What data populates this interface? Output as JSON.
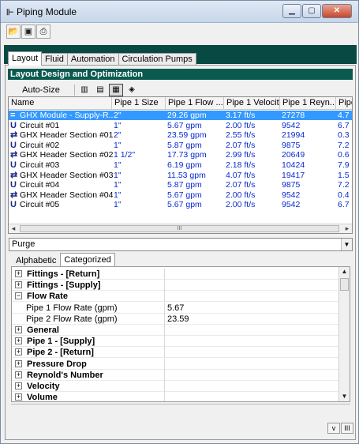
{
  "window": {
    "title": "Piping Module"
  },
  "toolbar": {
    "open_icon": "open-folder-icon",
    "save_icon": "save-icon",
    "print_icon": "print-icon"
  },
  "tabs": [
    {
      "label": "Layout",
      "active": true
    },
    {
      "label": "Fluid",
      "active": false
    },
    {
      "label": "Automation",
      "active": false
    },
    {
      "label": "Circulation Pumps",
      "active": false
    }
  ],
  "section": {
    "title": "Layout Design and Optimization"
  },
  "layout_toolbar": {
    "autosize_label": "Auto-Size"
  },
  "grid": {
    "columns": [
      "Name",
      "Pipe 1 Size",
      "Pipe 1 Flow ...",
      "Pipe 1 Velocity",
      "Pipe 1 Reyn...",
      "Pipe"
    ],
    "rows": [
      {
        "icon": "=",
        "name": "GHX Module - Supply-R...",
        "size": "2\"",
        "flow": "29.26 gpm",
        "velocity": "3.17 ft/s",
        "reynolds": "27278",
        "pipe": "4.7",
        "selected": true
      },
      {
        "icon": "U",
        "name": "Circuit #01",
        "size": "1\"",
        "flow": "5.67 gpm",
        "velocity": "2.00 ft/s",
        "reynolds": "9542",
        "pipe": "6.7",
        "selected": false
      },
      {
        "icon": "⇄",
        "name": "GHX Header Section #01",
        "size": "2\"",
        "flow": "23.59 gpm",
        "velocity": "2.55 ft/s",
        "reynolds": "21994",
        "pipe": "0.3",
        "selected": false
      },
      {
        "icon": "U",
        "name": "Circuit #02",
        "size": "1\"",
        "flow": "5.87 gpm",
        "velocity": "2.07 ft/s",
        "reynolds": "9875",
        "pipe": "7.2",
        "selected": false
      },
      {
        "icon": "⇄",
        "name": "GHX Header Section #02",
        "size": "1 1/2\"",
        "flow": "17.73 gpm",
        "velocity": "2.99 ft/s",
        "reynolds": "20649",
        "pipe": "0.6",
        "selected": false
      },
      {
        "icon": "U",
        "name": "Circuit #03",
        "size": "1\"",
        "flow": "6.19 gpm",
        "velocity": "2.18 ft/s",
        "reynolds": "10424",
        "pipe": "7.9",
        "selected": false
      },
      {
        "icon": "⇄",
        "name": "GHX Header Section #03",
        "size": "1\"",
        "flow": "11.53 gpm",
        "velocity": "4.07 ft/s",
        "reynolds": "19417",
        "pipe": "1.5",
        "selected": false
      },
      {
        "icon": "U",
        "name": "Circuit #04",
        "size": "1\"",
        "flow": "5.87 gpm",
        "velocity": "2.07 ft/s",
        "reynolds": "9875",
        "pipe": "7.2",
        "selected": false
      },
      {
        "icon": "⇄",
        "name": "GHX Header Section #04",
        "size": "1\"",
        "flow": "5.67 gpm",
        "velocity": "2.00 ft/s",
        "reynolds": "9542",
        "pipe": "0.4",
        "selected": false
      },
      {
        "icon": "U",
        "name": "Circuit #05",
        "size": "1\"",
        "flow": "5.67 gpm",
        "velocity": "2.00 ft/s",
        "reynolds": "9542",
        "pipe": "6.7",
        "selected": false
      }
    ],
    "scroll_grip": "III"
  },
  "purge": {
    "value": "Purge"
  },
  "property_tabs": [
    {
      "label": "Alphabetic",
      "active": false
    },
    {
      "label": "Categorized",
      "active": true
    }
  ],
  "properties": [
    {
      "label": "Fittings - [Return]",
      "type": "category",
      "expander": "+"
    },
    {
      "label": "Fittings - [Supply]",
      "type": "category",
      "expander": "+"
    },
    {
      "label": "Flow Rate",
      "type": "category",
      "expander": "−"
    },
    {
      "label": "Pipe 1 Flow Rate (gpm)",
      "type": "item",
      "value": "5.67"
    },
    {
      "label": "Pipe 2 Flow Rate (gpm)",
      "type": "item",
      "value": "23.59"
    },
    {
      "label": "General",
      "type": "category",
      "expander": "+"
    },
    {
      "label": "Pipe 1 - [Supply]",
      "type": "category",
      "expander": "+"
    },
    {
      "label": "Pipe 2 - [Return]",
      "type": "category",
      "expander": "+"
    },
    {
      "label": "Pressure Drop",
      "type": "category",
      "expander": "+"
    },
    {
      "label": "Reynold's Number",
      "type": "category",
      "expander": "+"
    },
    {
      "label": "Velocity",
      "type": "category",
      "expander": "+"
    },
    {
      "label": "Volume",
      "type": "category",
      "expander": "+"
    }
  ],
  "status": {
    "btn1": "v",
    "btn2": "III"
  }
}
